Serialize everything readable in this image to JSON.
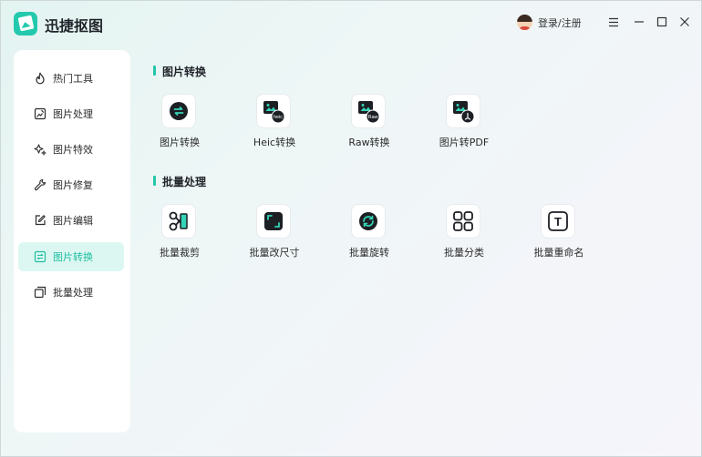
{
  "app": {
    "title": "迅捷抠图"
  },
  "header": {
    "login_label": "登录/注册"
  },
  "sidebar": {
    "items": [
      {
        "label": "热门工具",
        "icon": "flame-icon"
      },
      {
        "label": "图片处理",
        "icon": "image-edit-icon"
      },
      {
        "label": "图片特效",
        "icon": "sparkle-icon"
      },
      {
        "label": "图片修复",
        "icon": "wrench-icon"
      },
      {
        "label": "图片编辑",
        "icon": "pencil-square-icon"
      },
      {
        "label": "图片转换",
        "icon": "image-convert-icon",
        "active": true
      },
      {
        "label": "批量处理",
        "icon": "stack-icon"
      }
    ]
  },
  "sections": {
    "convert": {
      "title": "图片转换",
      "tools": [
        {
          "label": "图片转换",
          "icon": "convert-icon"
        },
        {
          "label": "Heic转换",
          "icon": "heic-icon",
          "badge": "heic"
        },
        {
          "label": "Raw转换",
          "icon": "raw-icon",
          "badge": "Raw"
        },
        {
          "label": "图片转PDF",
          "icon": "pdf-icon"
        }
      ]
    },
    "batch": {
      "title": "批量处理",
      "tools": [
        {
          "label": "批量裁剪",
          "icon": "scissors-icon"
        },
        {
          "label": "批量改尺寸",
          "icon": "resize-icon"
        },
        {
          "label": "批量旋转",
          "icon": "rotate-icon"
        },
        {
          "label": "批量分类",
          "icon": "grid-icon"
        },
        {
          "label": "批量重命名",
          "icon": "text-icon",
          "glyph": "T"
        }
      ]
    }
  },
  "colors": {
    "accent": "#23c6a9",
    "active_bg": "#dcf7f1",
    "text": "#2b2b2b"
  }
}
